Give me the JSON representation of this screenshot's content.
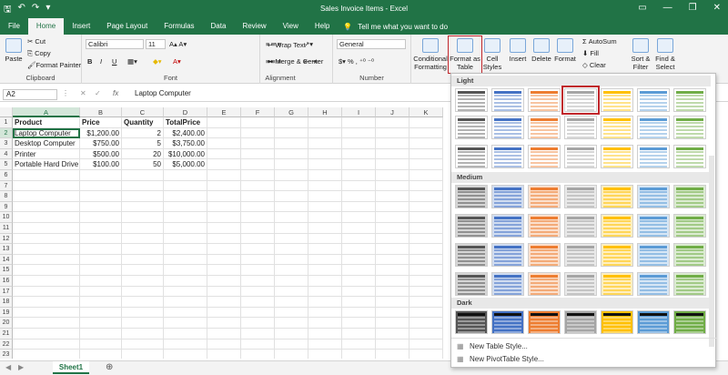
{
  "titlebar": {
    "title": "Sales Invoice Items  -  Excel",
    "tell_me": "Tell me what you want to do"
  },
  "tabs": [
    "File",
    "Home",
    "Insert",
    "Page Layout",
    "Formulas",
    "Data",
    "Review",
    "View",
    "Help"
  ],
  "active_tab": "Home",
  "ribbon": {
    "clipboard": {
      "paste": "Paste",
      "cut": "Cut",
      "copy": "Copy",
      "format_painter": "Format Painter",
      "label": "Clipboard"
    },
    "font": {
      "name": "Calibri",
      "size": "11",
      "label": "Font"
    },
    "alignment": {
      "wrap": "Wrap Text",
      "merge": "Merge & Center",
      "label": "Alignment"
    },
    "number": {
      "format": "General",
      "label": "Number"
    },
    "styles": {
      "conditional": "Conditional Formatting",
      "format_table": "Format as Table",
      "cell_styles": "Cell Styles"
    },
    "cells": {
      "insert": "Insert",
      "delete": "Delete",
      "format": "Format"
    },
    "editing": {
      "autosum": "AutoSum",
      "fill": "Fill",
      "clear": "Clear",
      "sort": "Sort & Filter",
      "find": "Find & Select"
    }
  },
  "formula_bar": {
    "name_box": "A2",
    "fx": "fx",
    "content": "Laptop Computer"
  },
  "columns": [
    "A",
    "B",
    "C",
    "D",
    "E",
    "F",
    "G",
    "H",
    "I",
    "J",
    "K"
  ],
  "rows": [
    [
      "Product",
      "Price",
      "Quantity",
      "TotalPrice"
    ],
    [
      "Laptop Computer",
      "$1,200.00",
      "2",
      "$2,400.00"
    ],
    [
      "Desktop Computer",
      "$750.00",
      "5",
      "$3,750.00"
    ],
    [
      "Printer",
      "$500.00",
      "20",
      "$10,000.00"
    ],
    [
      "Portable Hard Drive",
      "$100.00",
      "50",
      "$5,000.00"
    ]
  ],
  "row_count": 23,
  "sheet": {
    "name": "Sheet1",
    "add": "⊕"
  },
  "gallery": {
    "sections": [
      "Light",
      "Medium",
      "Dark"
    ],
    "menu": [
      "New Table Style...",
      "New PivotTable Style..."
    ],
    "colors": [
      "#555555",
      "#4472c4",
      "#ed7d31",
      "#a5a5a5",
      "#ffc000",
      "#5b9bd5",
      "#70ad47"
    ],
    "selected": "Light row 1 column 4"
  }
}
